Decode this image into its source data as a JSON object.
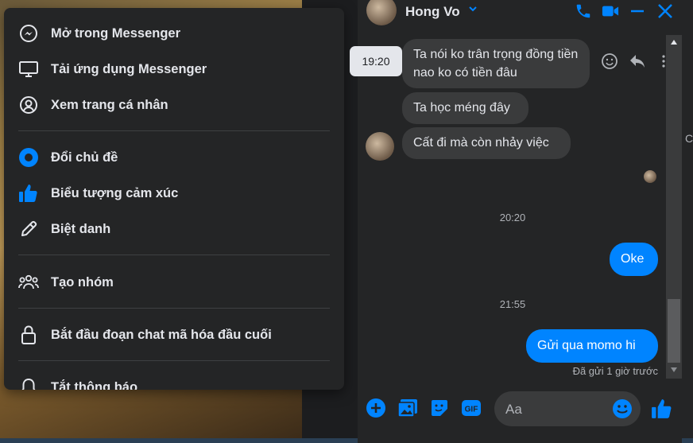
{
  "menu": {
    "items": [
      {
        "label": "Mở trong Messenger",
        "icon": "messenger-icon"
      },
      {
        "label": "Tải ứng dụng Messenger",
        "icon": "monitor-icon"
      },
      {
        "label": "Xem trang cá nhân",
        "icon": "profile-icon"
      },
      {
        "label": "Đổi chủ đề",
        "icon": "theme-icon"
      },
      {
        "label": "Biểu tượng cảm xúc",
        "icon": "thumbs-up-icon"
      },
      {
        "label": "Biệt danh",
        "icon": "pencil-icon"
      },
      {
        "label": "Tạo nhóm",
        "icon": "group-icon"
      },
      {
        "label": "Bắt đầu đoạn chat mã hóa đầu cuối",
        "icon": "lock-icon"
      },
      {
        "label": "Tắt thông báo",
        "icon": "bell-icon"
      }
    ]
  },
  "chat": {
    "contact_name": "Hong Vo",
    "tooltip_time": "19:20",
    "messages_in": [
      {
        "text": "Ta nói ko trân trọng đồng tiền nao ko có tiền đâu"
      },
      {
        "text": "Ta học méng đây"
      },
      {
        "text": "Cất đi mà còn nhảy việc"
      }
    ],
    "time_1": "20:20",
    "out_1": "Oke",
    "time_2": "21:55",
    "out_2": "Gửi qua momo hi",
    "status": "Đã gửi 1 giờ trước",
    "composer_placeholder": "Aa"
  },
  "colors": {
    "accent": "#0084ff",
    "menu_bg": "#242526",
    "bubble_in": "#3a3b3c"
  }
}
